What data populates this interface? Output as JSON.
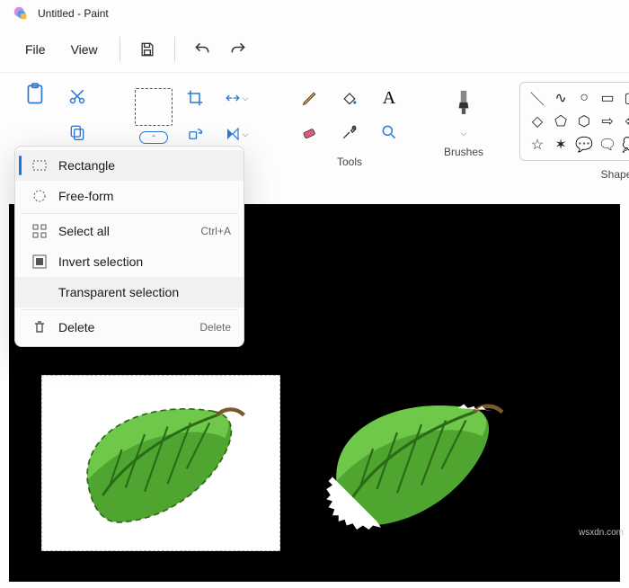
{
  "window": {
    "title": "Untitled - Paint"
  },
  "menubar": {
    "file": "File",
    "view": "View"
  },
  "ribbon": {
    "tools_label": "Tools",
    "brushes_label": "Brushes",
    "shapes_label": "Shapes"
  },
  "dropdown": {
    "rectangle": "Rectangle",
    "freeform": "Free-form",
    "select_all": "Select all",
    "select_all_shortcut": "Ctrl+A",
    "invert": "Invert selection",
    "transparent": "Transparent selection",
    "delete": "Delete",
    "delete_shortcut": "Delete"
  },
  "watermark": "wsxdn.com"
}
